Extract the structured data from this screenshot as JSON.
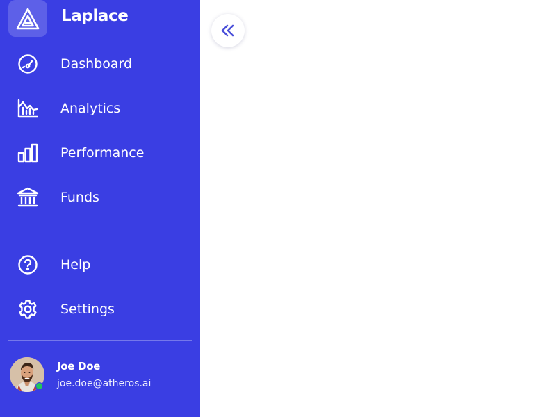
{
  "brand": {
    "name": "Laplace",
    "logo_icon": "triangle-logo-icon"
  },
  "nav_primary": [
    {
      "label": "Dashboard",
      "icon": "gauge-icon"
    },
    {
      "label": "Analytics",
      "icon": "line-chart-icon"
    },
    {
      "label": "Performance",
      "icon": "bar-chart-icon"
    },
    {
      "label": "Funds",
      "icon": "bank-icon"
    }
  ],
  "nav_secondary": [
    {
      "label": "Help",
      "icon": "help-circle-icon"
    },
    {
      "label": "Settings",
      "icon": "gear-icon"
    }
  ],
  "user": {
    "name": "Joe Doe",
    "email": "joe.doe@atheros.ai",
    "status": "online"
  },
  "colors": {
    "sidebar_bg": "#3a3ee3",
    "text": "#ffffff",
    "online": "#22c55e",
    "accent": "#4a4fd9"
  },
  "collapse_button": {
    "icon": "chevrons-left-icon"
  }
}
